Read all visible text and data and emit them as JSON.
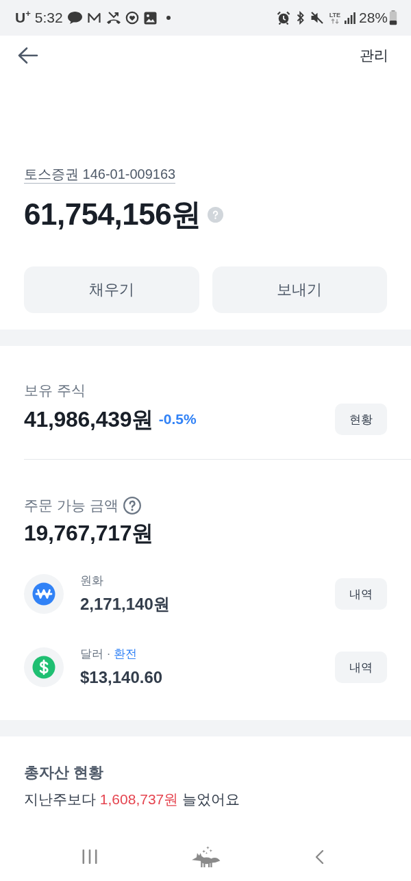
{
  "status_bar": {
    "carrier": "U$^{+}$",
    "time": "5:32",
    "network": "LTE",
    "battery": "28%"
  },
  "header": {
    "action": "관리"
  },
  "account": {
    "label": "토스증권 146-01-009163",
    "total": "61,754,156원"
  },
  "actions": [
    "채우기",
    "보내기"
  ],
  "holdings": {
    "title": "보유 주식",
    "amount": "41,986,439원",
    "change": "-0.5%",
    "gain": false,
    "button": "현황"
  },
  "orderable": {
    "title": "주문 가능 금액",
    "amount": "19,767,717원",
    "accounts": [
      {
        "kind": "krw",
        "label": "원화",
        "amount": "2,171,140원",
        "button": "내역"
      },
      {
        "kind": "usd",
        "label": "달러",
        "separator": "·",
        "link": "환전",
        "amount": "$13,140.60",
        "button": "내역"
      }
    ]
  },
  "total_assets": {
    "title": "총자산 현황",
    "before": "지난주보다",
    "amount": "1,608,737원",
    "after": "늘었어요",
    "gain": true
  }
}
